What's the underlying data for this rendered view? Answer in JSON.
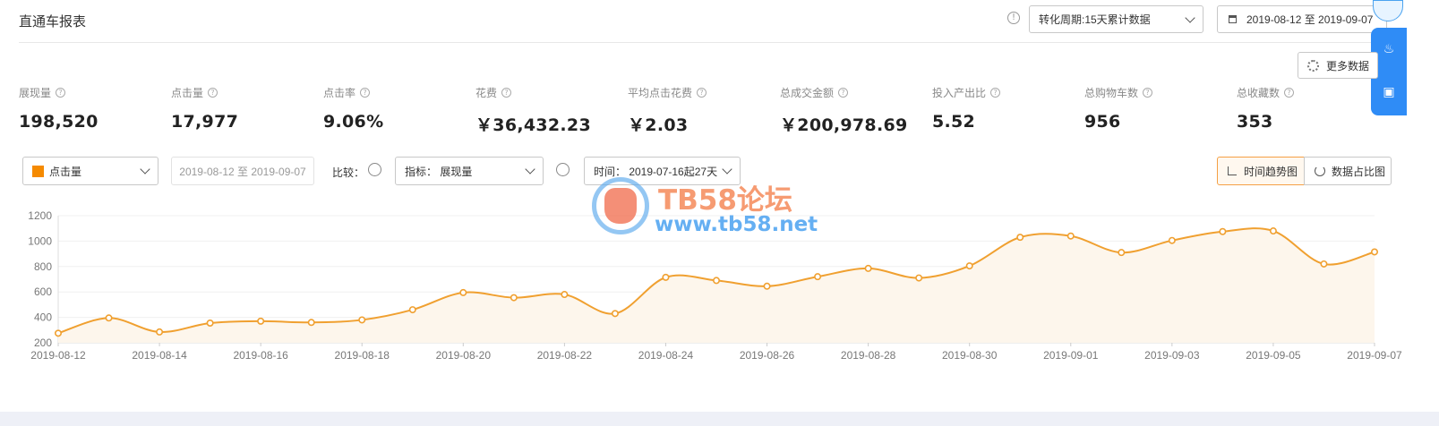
{
  "header": {
    "title": "直通车报表",
    "info_icon": "!",
    "conversion_period": "转化周期:15天累计数据",
    "date_range": "2019-08-12 至 2019-09-07"
  },
  "toolbar": {
    "more_data_label": "更多数据"
  },
  "metrics": [
    {
      "label": "展现量",
      "value": "198,520"
    },
    {
      "label": "点击量",
      "value": "17,977"
    },
    {
      "label": "点击率",
      "value": "9.06%"
    },
    {
      "label": "花费",
      "value": "￥36,432.23"
    },
    {
      "label": "平均点击花费",
      "value": "￥2.03"
    },
    {
      "label": "总成交金额",
      "value": "￥200,978.69"
    },
    {
      "label": "投入产出比",
      "value": "5.52"
    },
    {
      "label": "总购物车数",
      "value": "956"
    },
    {
      "label": "总收藏数",
      "value": "353"
    }
  ],
  "controls": {
    "metric_select": "点击量",
    "date_input": "2019-08-12 至 2019-09-07",
    "compare_label": "比较：",
    "indicator_select": "指标： 展现量",
    "time_select": "时间： 2019-07-16起27天",
    "trend_view_label": "时间趋势图",
    "share_view_label": "数据占比图"
  },
  "watermark": {
    "title": "TB58论坛",
    "url": "www.tb58.net"
  },
  "colors": {
    "series": "#f0a030",
    "area": "#fdf6ec",
    "accent": "#2f8cf6"
  },
  "chart_data": {
    "type": "line",
    "series": [
      {
        "values": [
          275,
          395,
          285,
          355,
          370,
          360,
          380,
          460,
          595,
          555,
          580,
          430,
          715,
          690,
          645,
          720,
          785,
          710,
          805,
          1030,
          1040,
          910,
          1005,
          1075,
          1080,
          820,
          915
        ]
      }
    ],
    "x": [
      "2019-08-12",
      "2019-08-13",
      "2019-08-14",
      "2019-08-15",
      "2019-08-16",
      "2019-08-17",
      "2019-08-18",
      "2019-08-19",
      "2019-08-20",
      "2019-08-21",
      "2019-08-22",
      "2019-08-23",
      "2019-08-24",
      "2019-08-25",
      "2019-08-26",
      "2019-08-27",
      "2019-08-28",
      "2019-08-29",
      "2019-08-30",
      "2019-08-31",
      "2019-09-01",
      "2019-09-02",
      "2019-09-03",
      "2019-09-04",
      "2019-09-05",
      "2019-09-06",
      "2019-09-07"
    ],
    "x_tick_labels": [
      "2019-08-12",
      "2019-08-14",
      "2019-08-16",
      "2019-08-18",
      "2019-08-20",
      "2019-08-22",
      "2019-08-24",
      "2019-08-26",
      "2019-08-28",
      "2019-08-30",
      "2019-09-01",
      "2019-09-03",
      "2019-09-05",
      "2019-09-07"
    ],
    "y_ticks": [
      200,
      400,
      600,
      800,
      1000,
      1200
    ],
    "ylim": [
      200,
      1200
    ],
    "grid": true,
    "title": "",
    "xlabel": "",
    "ylabel": ""
  }
}
